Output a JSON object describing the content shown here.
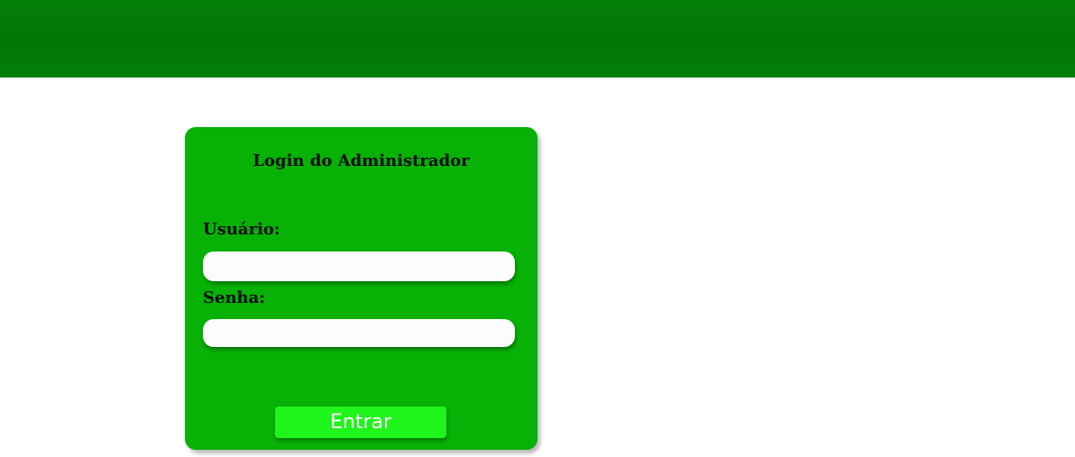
{
  "login": {
    "title": "Login do Administrador",
    "username_label": "Usuário:",
    "username_value": "",
    "password_label": "Senha:",
    "password_value": "",
    "submit_label": "Entrar"
  },
  "colors": {
    "header": "#037a08",
    "card": "#08b105",
    "button": "#20f51b"
  }
}
